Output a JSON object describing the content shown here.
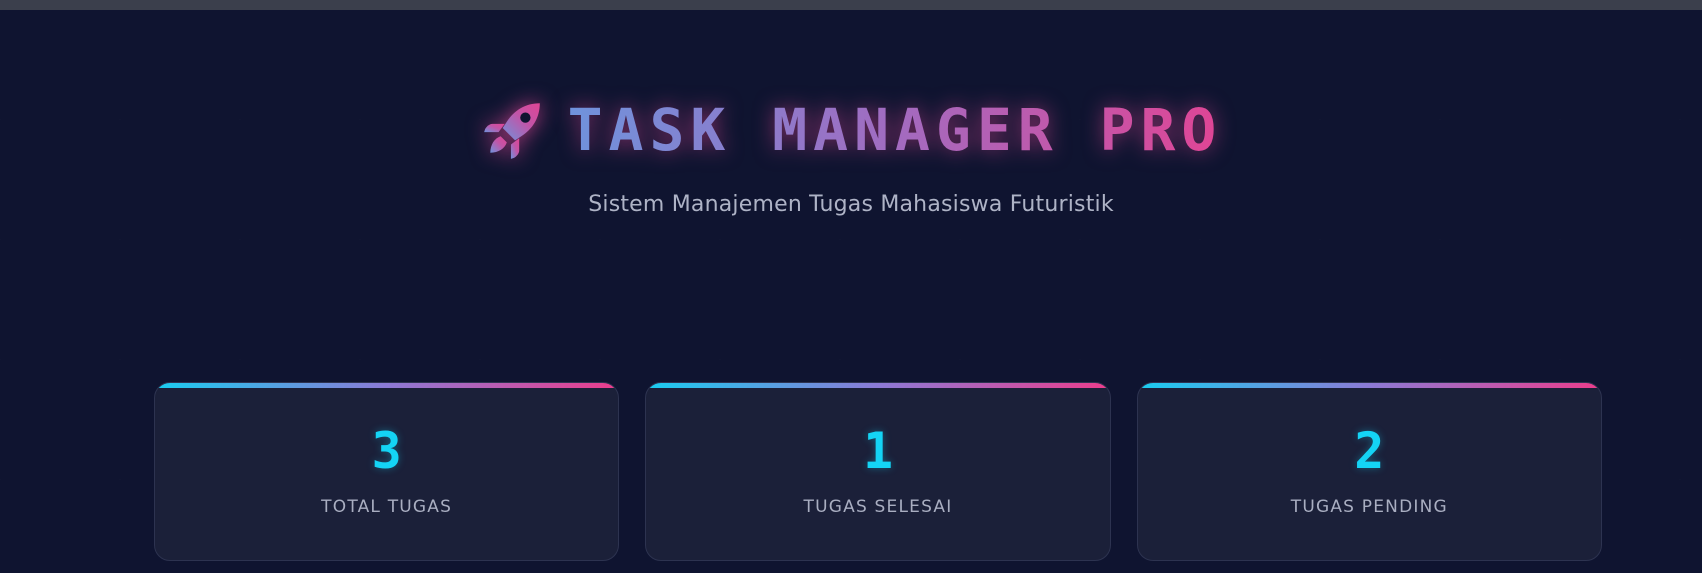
{
  "header": {
    "title": "TASK MANAGER PRO",
    "subtitle": "Sistem Manajemen Tugas Mahasiswa Futuristik",
    "icon": "rocket-icon"
  },
  "stats": [
    {
      "value": "3",
      "label": "TOTAL TUGAS"
    },
    {
      "value": "1",
      "label": "TUGAS SELESAI"
    },
    {
      "value": "2",
      "label": "TUGAS PENDING"
    }
  ],
  "colors": {
    "background": "#0f1430",
    "card": "#1b2039",
    "accent_cyan": "#14d4f5",
    "accent_pink": "#ec3d8c",
    "accent_blue": "#6f93dc"
  }
}
